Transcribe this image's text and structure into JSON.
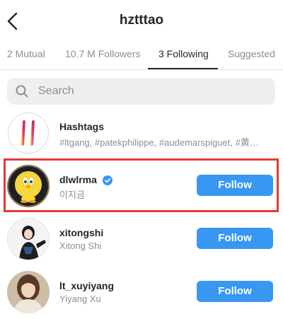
{
  "header": {
    "title": "hztttao"
  },
  "tabs": [
    {
      "label": "2 Mutual"
    },
    {
      "label": "10.7 M Followers"
    },
    {
      "label": "3 Following",
      "active": true
    },
    {
      "label": "Suggested"
    }
  ],
  "search": {
    "placeholder": "Search"
  },
  "rows": [
    {
      "name": "Hashtags",
      "subtitle": "#ltgang, #patekphilippe, #audemarspiguet, #黄…",
      "avatar_icon": "hashtag-icon"
    },
    {
      "name": "dlwlrma",
      "subtitle": "이지금",
      "verified": true,
      "button": "Follow",
      "avatar_icon": "tweety-avatar"
    },
    {
      "name": "xitongshi",
      "subtitle": "Xitong Shi",
      "button": "Follow",
      "avatar_icon": "person-avatar"
    },
    {
      "name": "lt_xuyiyang",
      "subtitle": "Yiyang Xu",
      "button": "Follow",
      "avatar_icon": "person-avatar"
    }
  ],
  "colors": {
    "follow_button": "#3897f0",
    "highlight": "#e53935",
    "hashtag_gradient": [
      "#f9a334",
      "#c13584"
    ]
  }
}
